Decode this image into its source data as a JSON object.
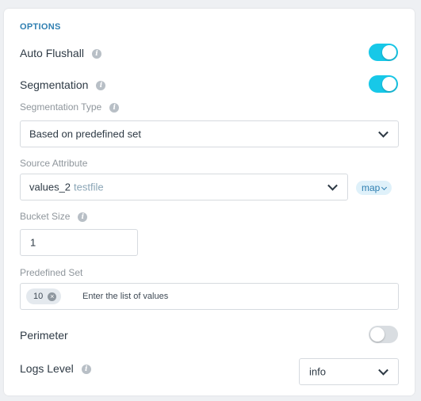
{
  "section": {
    "title": "OPTIONS"
  },
  "auto_flushall": {
    "label": "Auto Flushall",
    "enabled": true
  },
  "segmentation": {
    "label": "Segmentation",
    "enabled": true
  },
  "segmentation_type": {
    "label": "Segmentation Type",
    "value": "Based on predefined set"
  },
  "source_attribute": {
    "label": "Source Attribute",
    "value": "values_2",
    "source": "testfile",
    "map_label": "map"
  },
  "bucket_size": {
    "label": "Bucket Size",
    "value": "1"
  },
  "predefined_set": {
    "label": "Predefined Set",
    "tags": [
      "10"
    ],
    "placeholder": "Enter the list of values"
  },
  "perimeter": {
    "label": "Perimeter",
    "enabled": false
  },
  "logs_level": {
    "label": "Logs Level",
    "value": "info"
  },
  "colors": {
    "accent": "#17c8e8",
    "title": "#2f7fb1"
  }
}
